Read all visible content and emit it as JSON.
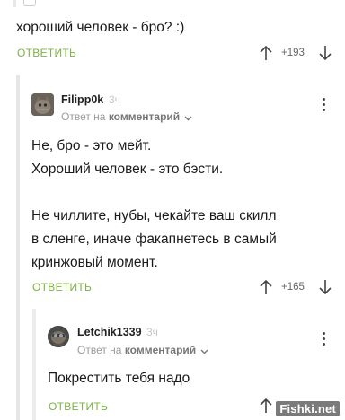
{
  "top_comment": {
    "text": "хороший человек - бро? :)",
    "reply_label": "ОТВЕТИТЬ",
    "score": "+193"
  },
  "reply_1": {
    "username": "Filipp0k",
    "time_ago": "3ч",
    "meta_prefix": "Ответ на",
    "meta_link": "комментарий",
    "lines": [
      "Не, бро - это мейт.",
      "Хороший человек - это бэсти.",
      "",
      "Не чиллите, нубы, чекайте ваш скилл",
      "в сленге, иначе факапнетесь в самый",
      "кринжовый момент."
    ],
    "reply_label": "ОТВЕТИТЬ",
    "score": "+165"
  },
  "reply_2": {
    "username": "Letchik1339",
    "time_ago": "3ч",
    "meta_prefix": "Ответ на",
    "meta_link": "комментарий",
    "text": "Покрестить тебя надо",
    "reply_label": "ОТВЕТИТЬ"
  },
  "watermark": "Fishki.net",
  "colors": {
    "accent_green": "#7cb342",
    "thread_line": "#e6e6e6",
    "muted_text": "#9b9b9b"
  },
  "icons": [
    "arrow-up-icon",
    "arrow-down-icon",
    "chevron-down-icon",
    "kebab-menu-icon"
  ]
}
